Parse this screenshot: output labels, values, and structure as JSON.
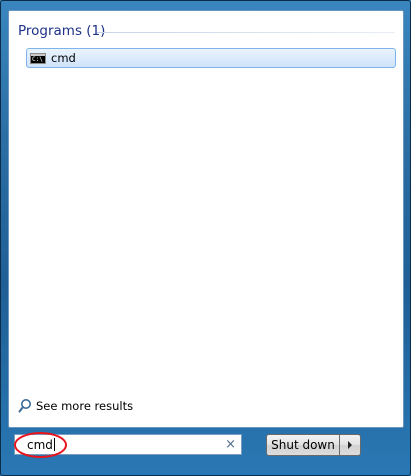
{
  "results": {
    "section_title": "Programs (1)",
    "items": [
      {
        "label": "cmd",
        "icon": "command-prompt-icon"
      }
    ],
    "see_more_label": "See more results"
  },
  "search": {
    "value": "cmd",
    "clear_icon": "×"
  },
  "power": {
    "shutdown_label": "Shut down",
    "arrow_icon": "chevron-right-icon"
  },
  "colors": {
    "header_text": "#1e3287",
    "item_highlight": "#dcebfc",
    "item_border": "#7eb4ea",
    "annotation_oval": "#e8141c"
  }
}
